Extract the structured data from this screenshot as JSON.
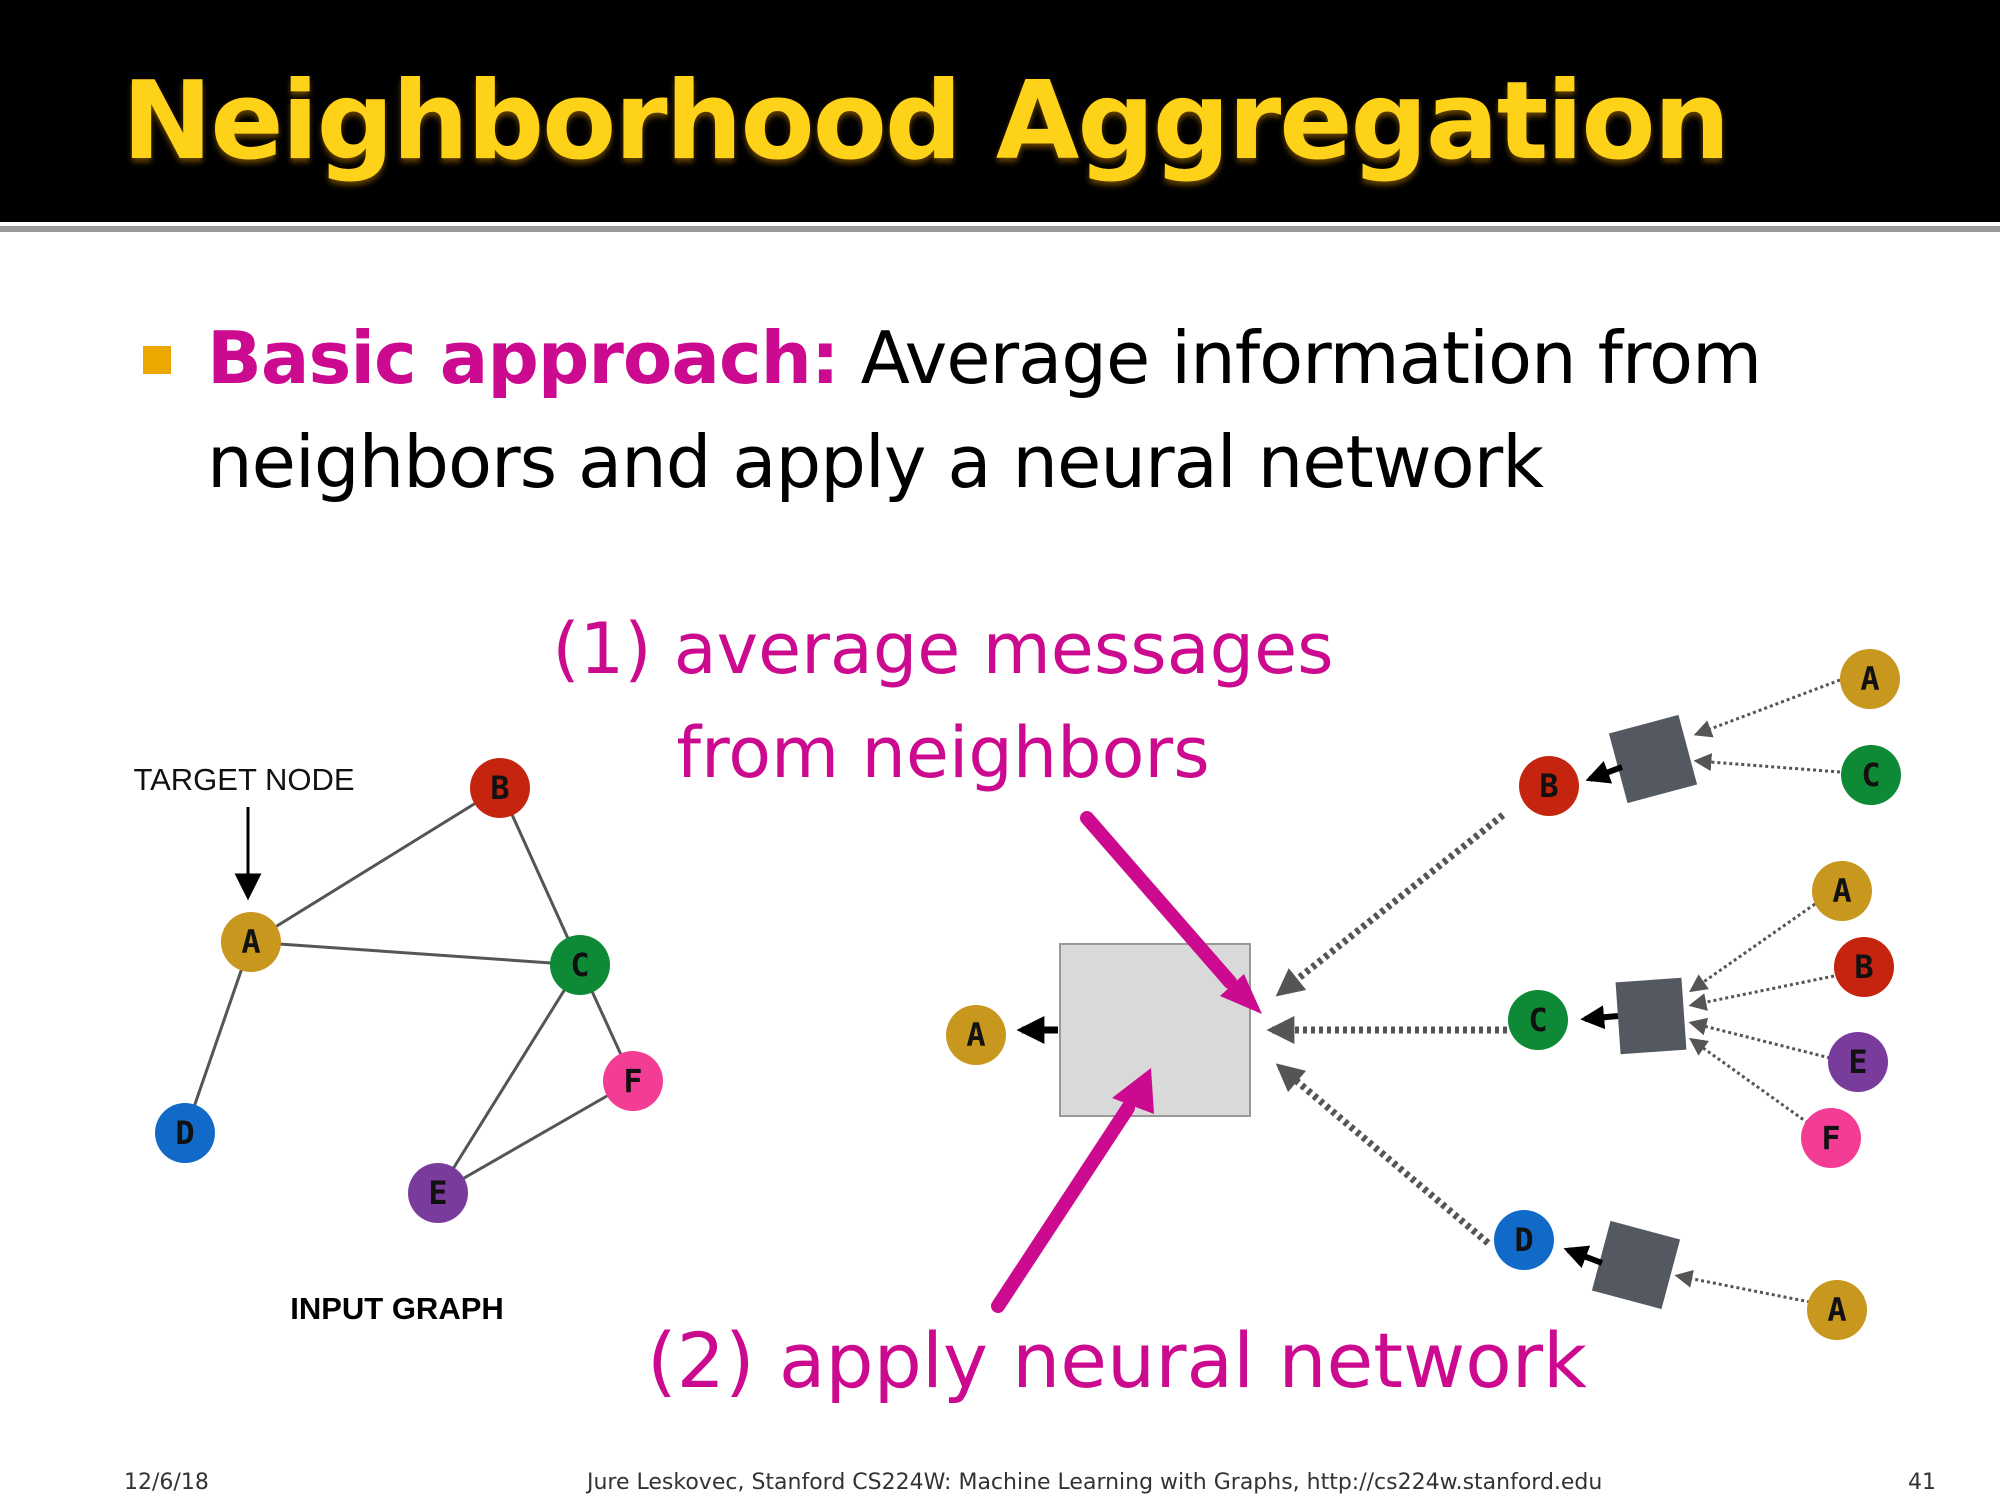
{
  "slide": {
    "title": "Neighborhood Aggregation",
    "bullet_label": "Basic approach:",
    "bullet_text": "Average information from neighbors and apply a neural network"
  },
  "colors": {
    "title": "#ffd21a",
    "accent": "#cc0a8f",
    "bullet_marker": "#eaa800",
    "box": "#d9d9d9",
    "nn_block": "#545860"
  },
  "diagram": {
    "target_node_label": "TARGET NODE",
    "input_graph_label": "INPUT GRAPH",
    "annotation_1_line1": "(1) average messages",
    "annotation_1_line2": "from neighbors",
    "annotation_2": "(2) apply neural network",
    "node_colors": {
      "A": "#c8971e",
      "B": "#c5250f",
      "C": "#0e8a36",
      "D": "#1169c8",
      "E": "#7a3c9c",
      "F": "#f33d95"
    },
    "input_graph": {
      "nodes": [
        "A",
        "B",
        "C",
        "D",
        "E",
        "F"
      ],
      "edges": [
        [
          "A",
          "B"
        ],
        [
          "A",
          "C"
        ],
        [
          "A",
          "D"
        ],
        [
          "B",
          "C"
        ],
        [
          "C",
          "E"
        ],
        [
          "C",
          "F"
        ],
        [
          "E",
          "F"
        ]
      ]
    },
    "computation_graph": {
      "target": "A",
      "neighbors": [
        {
          "node": "B",
          "children": [
            "A",
            "C"
          ]
        },
        {
          "node": "C",
          "children": [
            "A",
            "B",
            "E",
            "F"
          ]
        },
        {
          "node": "D",
          "children": [
            "A"
          ]
        }
      ]
    }
  },
  "footer": {
    "date": "12/6/18",
    "citation": "Jure Leskovec, Stanford CS224W: Machine Learning with Graphs, http://cs224w.stanford.edu",
    "page_number": "41"
  }
}
